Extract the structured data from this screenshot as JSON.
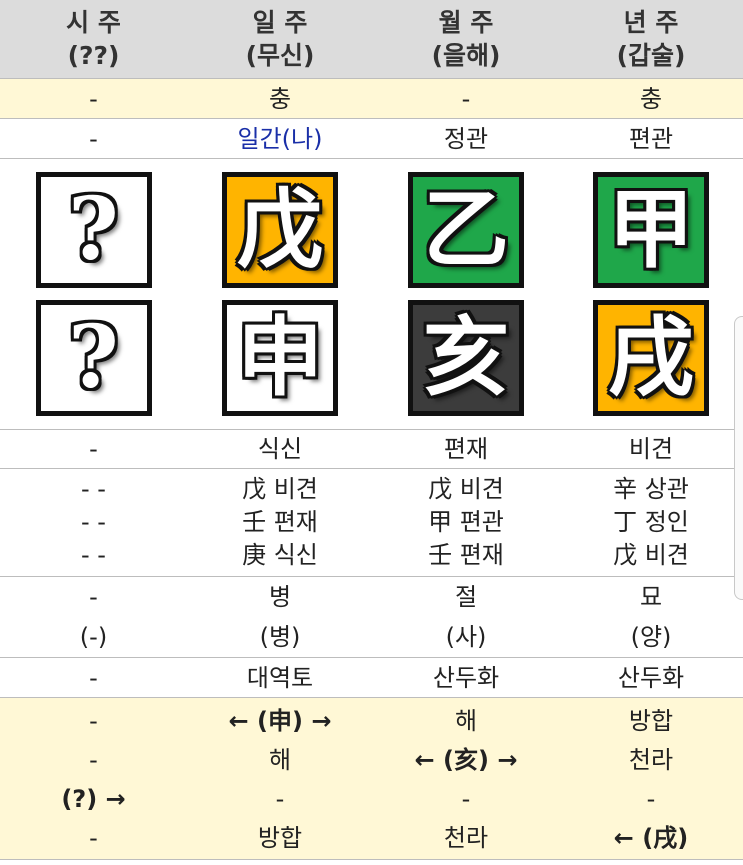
{
  "columns": [
    {
      "title": "시 주",
      "sub": "(??)"
    },
    {
      "title": "일 주",
      "sub": "(무신)"
    },
    {
      "title": "월 주",
      "sub": "(을해)"
    },
    {
      "title": "년 주",
      "sub": "(갑술)"
    }
  ],
  "clash": [
    "-",
    "충",
    "-",
    "충"
  ],
  "ten_gods_top": [
    "-",
    "일간(나)",
    "정관",
    "편관"
  ],
  "stems": [
    {
      "char": "?",
      "color": "#ffffff"
    },
    {
      "char": "戊",
      "color": "#ffb400"
    },
    {
      "char": "乙",
      "color": "#1fa74a"
    },
    {
      "char": "甲",
      "color": "#1fa74a"
    }
  ],
  "branches": [
    {
      "char": "?",
      "color": "#ffffff"
    },
    {
      "char": "申",
      "color": "#ffffff"
    },
    {
      "char": "亥",
      "color": "#3c3c3c"
    },
    {
      "char": "戌",
      "color": "#ffb400"
    }
  ],
  "ten_gods_bottom": [
    "-",
    "식신",
    "편재",
    "비견"
  ],
  "hidden_stems": [
    [
      "- -",
      "- -",
      "- -"
    ],
    [
      "戊 비견",
      "壬 편재",
      "庚 식신"
    ],
    [
      "戊 비견",
      "甲 편관",
      "壬 편재"
    ],
    [
      "辛 상관",
      "丁 정인",
      "戊 비견"
    ]
  ],
  "stages": [
    [
      "-",
      "(-)"
    ],
    [
      "병",
      "(병)"
    ],
    [
      "절",
      "(사)"
    ],
    [
      "묘",
      "(양)"
    ]
  ],
  "napeum": [
    "-",
    "대역토",
    "산두화",
    "산두화"
  ],
  "relations": [
    [
      "-",
      "-",
      "(?) →",
      "-"
    ],
    [
      "← (申) →",
      "해",
      "-",
      "방합"
    ],
    [
      "해",
      "← (亥) →",
      "-",
      "천라"
    ],
    [
      "방합",
      "천라",
      "-",
      "← (戌)"
    ]
  ]
}
